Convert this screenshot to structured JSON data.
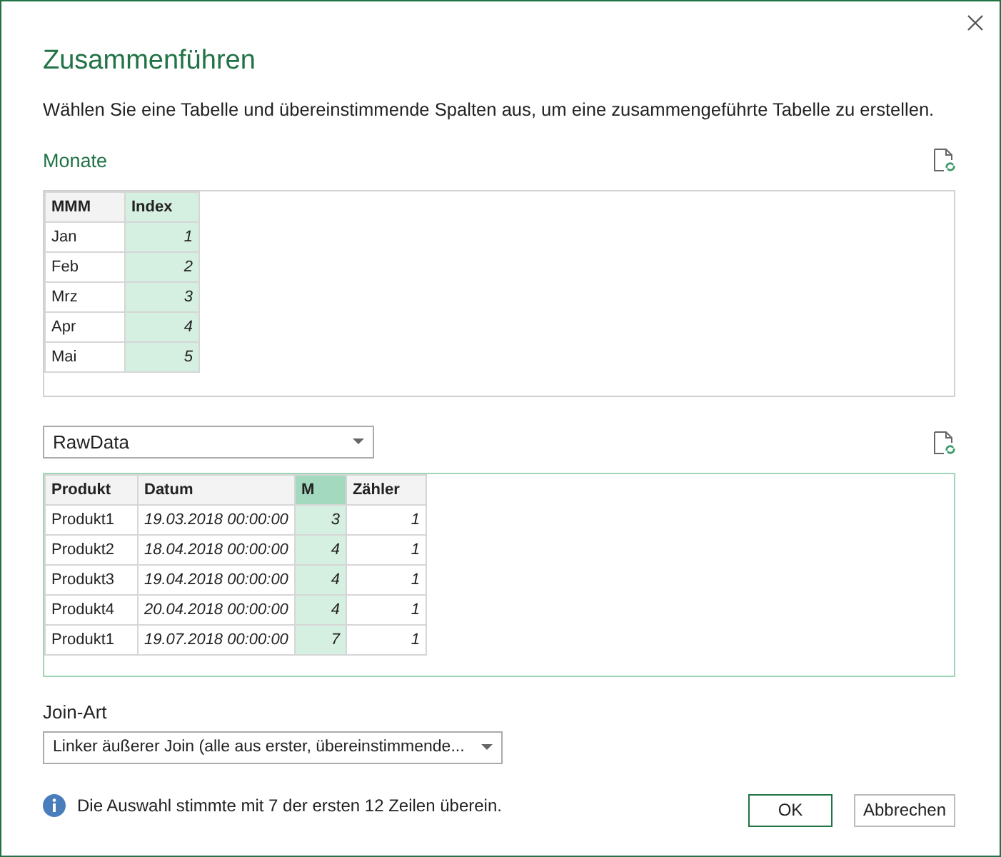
{
  "title": "Zusammenführen",
  "description": "Wählen Sie eine Tabelle und übereinstimmende Spalten aus, um eine zusammengeführte Tabelle zu erstellen.",
  "table1": {
    "name": "Monate",
    "focused": false,
    "columns": [
      {
        "label": "MMM",
        "selected": false
      },
      {
        "label": "Index",
        "selected": true
      }
    ],
    "rows": [
      {
        "cells": [
          "Jan",
          "1"
        ]
      },
      {
        "cells": [
          "Feb",
          "2"
        ]
      },
      {
        "cells": [
          "Mrz",
          "3"
        ]
      },
      {
        "cells": [
          "Apr",
          "4"
        ]
      },
      {
        "cells": [
          "Mai",
          "5"
        ]
      }
    ]
  },
  "table2": {
    "source": "RawData",
    "focused": true,
    "columns": [
      {
        "label": "Produkt",
        "selected": false,
        "kind": "text"
      },
      {
        "label": "Datum",
        "selected": false,
        "kind": "date"
      },
      {
        "label": "M",
        "selected": true,
        "kind": "number"
      },
      {
        "label": "Zähler",
        "selected": false,
        "kind": "number"
      }
    ],
    "rows": [
      {
        "cells": [
          "Produkt1",
          "19.03.2018 00:00:00",
          "3",
          "1"
        ]
      },
      {
        "cells": [
          "Produkt2",
          "18.04.2018 00:00:00",
          "4",
          "1"
        ]
      },
      {
        "cells": [
          "Produkt3",
          "19.04.2018 00:00:00",
          "4",
          "1"
        ]
      },
      {
        "cells": [
          "Produkt4",
          "20.04.2018 00:00:00",
          "4",
          "1"
        ]
      },
      {
        "cells": [
          "Produkt1",
          "19.07.2018 00:00:00",
          "7",
          "1"
        ]
      }
    ]
  },
  "join_label": "Join-Art",
  "join_value": "Linker äußerer Join (alle aus erster, übereinstimmende...",
  "info": "Die Auswahl stimmte mit 7 der ersten 12 Zeilen überein.",
  "buttons": [
    {
      "label": "OK",
      "kind": "primary"
    },
    {
      "label": "Abbrechen",
      "kind": "secondary"
    }
  ]
}
